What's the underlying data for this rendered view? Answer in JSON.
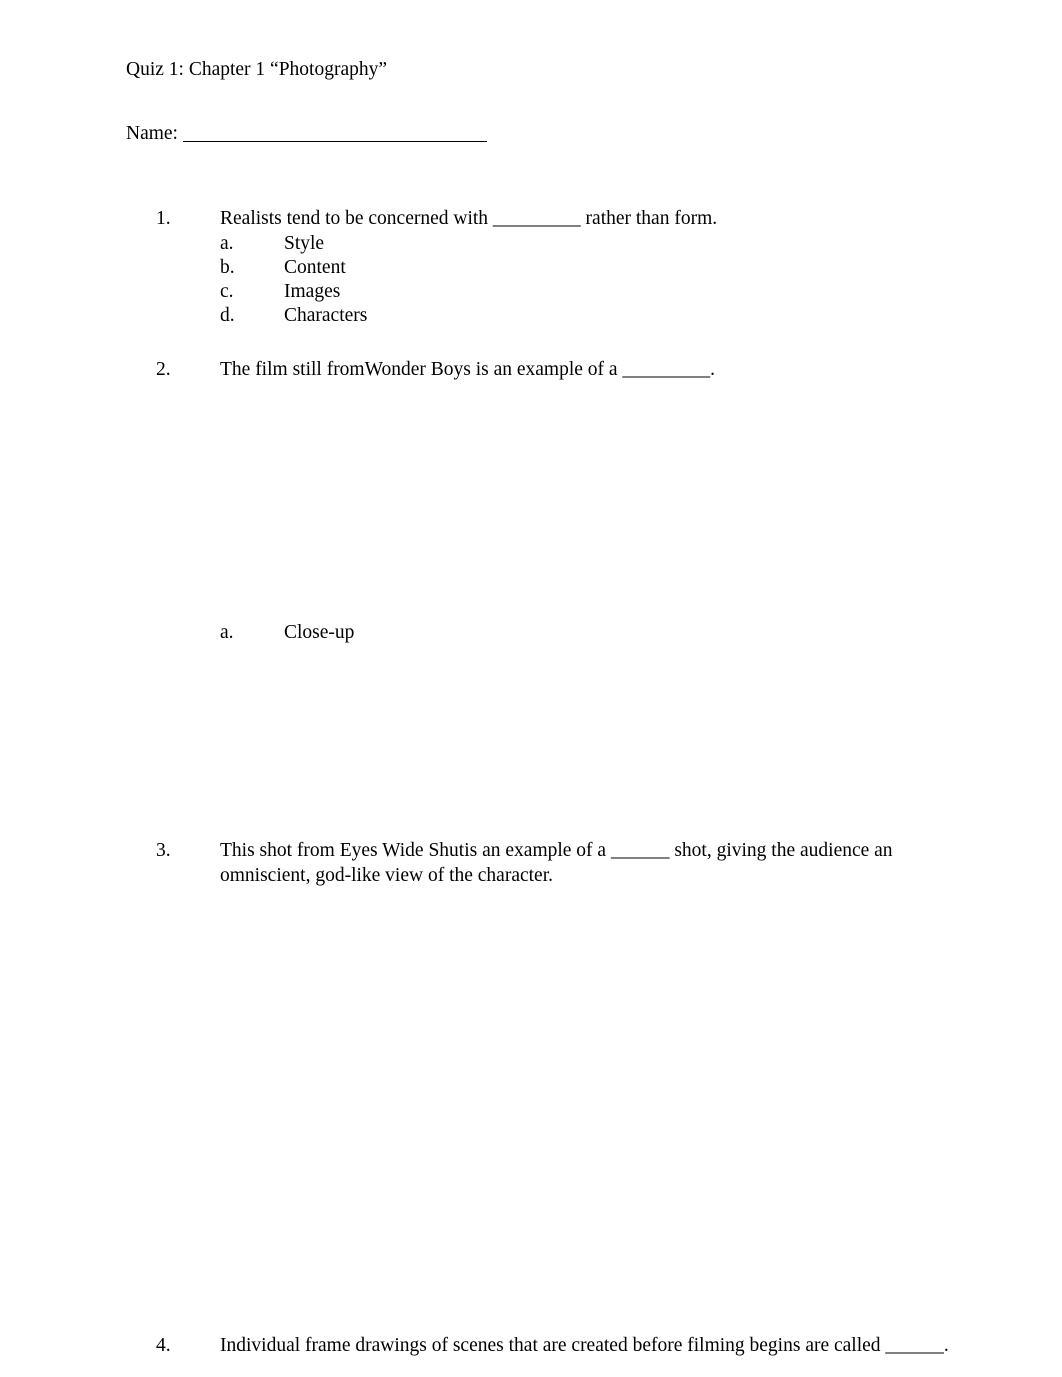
{
  "document": {
    "title": "Quiz 1: Chapter 1 “Photography”",
    "name_field": {
      "label": "Name:",
      "value": ""
    }
  },
  "questions": [
    {
      "number": "1.",
      "text": "Realists tend to be concerned with _________ rather than form.",
      "options": [
        {
          "letter": "a.",
          "text": "Style"
        },
        {
          "letter": "b.",
          "text": "Content"
        },
        {
          "letter": "c.",
          "text": "Images"
        },
        {
          "letter": "d.",
          "text": "Characters"
        }
      ]
    },
    {
      "number": "2.",
      "text": "The film still fromWonder Boys is an example of a _________.",
      "options": [
        {
          "letter": "a.",
          "text": "Close-up"
        }
      ]
    },
    {
      "number": "3.",
      "text": "This shot from Eyes Wide Shutis an example of a ______ shot, giving the audience an omniscient, god-like view of the character.",
      "options": []
    },
    {
      "number": "4.",
      "text": "Individual frame drawings of scenes that are created before filming begins are called ______.",
      "options": []
    }
  ]
}
